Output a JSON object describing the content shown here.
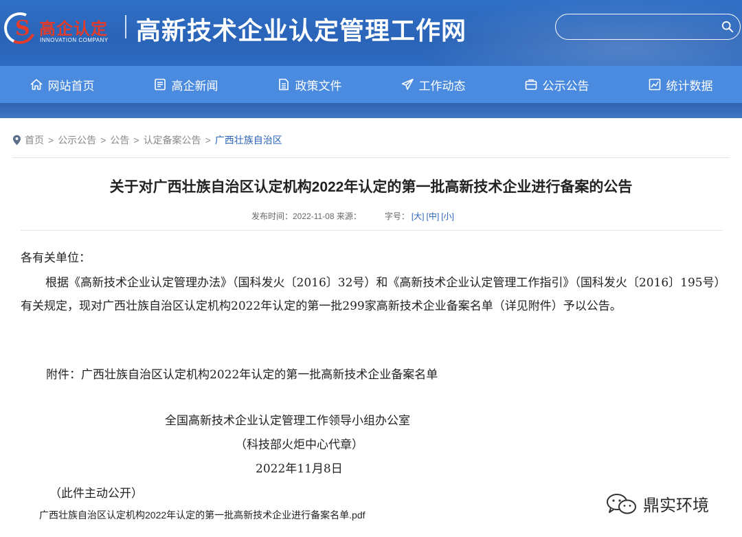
{
  "header": {
    "logo_title": "高企认定",
    "logo_subtitle": "INNOVATION COMPANY",
    "site_title": "高新技术企业认定管理工作网",
    "search_placeholder": ""
  },
  "nav": {
    "items": [
      {
        "label": "网站首页",
        "icon": "home-icon"
      },
      {
        "label": "高企新闻",
        "icon": "news-icon"
      },
      {
        "label": "政策文件",
        "icon": "document-icon"
      },
      {
        "label": "工作动态",
        "icon": "paper-plane-icon"
      },
      {
        "label": "公示公告",
        "icon": "briefcase-icon"
      },
      {
        "label": "统计数据",
        "icon": "chart-icon"
      }
    ]
  },
  "breadcrumb": {
    "items": [
      "首页",
      ">",
      "公示公告",
      ">",
      "公告",
      ">",
      "认定备案公告",
      ">",
      "广西壮族自治区"
    ]
  },
  "article": {
    "title": "关于对广西壮族自治区认定机构2022年认定的第一批高新技术企业进行备案的公告",
    "meta_published": "发布时间：2022-11-08 来源：",
    "meta_font_label": "字号：",
    "font_sizes": [
      "[大]",
      "[中]",
      "[小]"
    ],
    "salutation": "各有关单位：",
    "paragraph": "根据《高新技术企业认定管理办法》（国科发火〔2016〕32号）和《高新技术企业认定管理工作指引》（国科发火〔2016〕195号）有关规定，现对广西壮族自治区认定机构2022年认定的第一批299家高新技术企业备案名单（详见附件）予以公告。",
    "attachment_note": "附件：广西壮族自治区认定机构2022年认定的第一批高新技术企业备案名单",
    "signature_org": "全国高新技术企业认定管理工作领导小组办公室",
    "signature_agent": "（科技部火炬中心代章）",
    "signature_date": "2022年11月8日",
    "public_note": "（此件主动公开）",
    "attachment_link": "广西壮族自治区认定机构2022年认定的第一批高新技术企业进行备案名单.pdf"
  },
  "watermark": {
    "text": "鼎实环境"
  },
  "colors": {
    "header_blue": "#2a64b8",
    "nav_blue": "#4a8be0",
    "logo_red": "#e23b2a",
    "link_blue": "#2a64b8"
  }
}
